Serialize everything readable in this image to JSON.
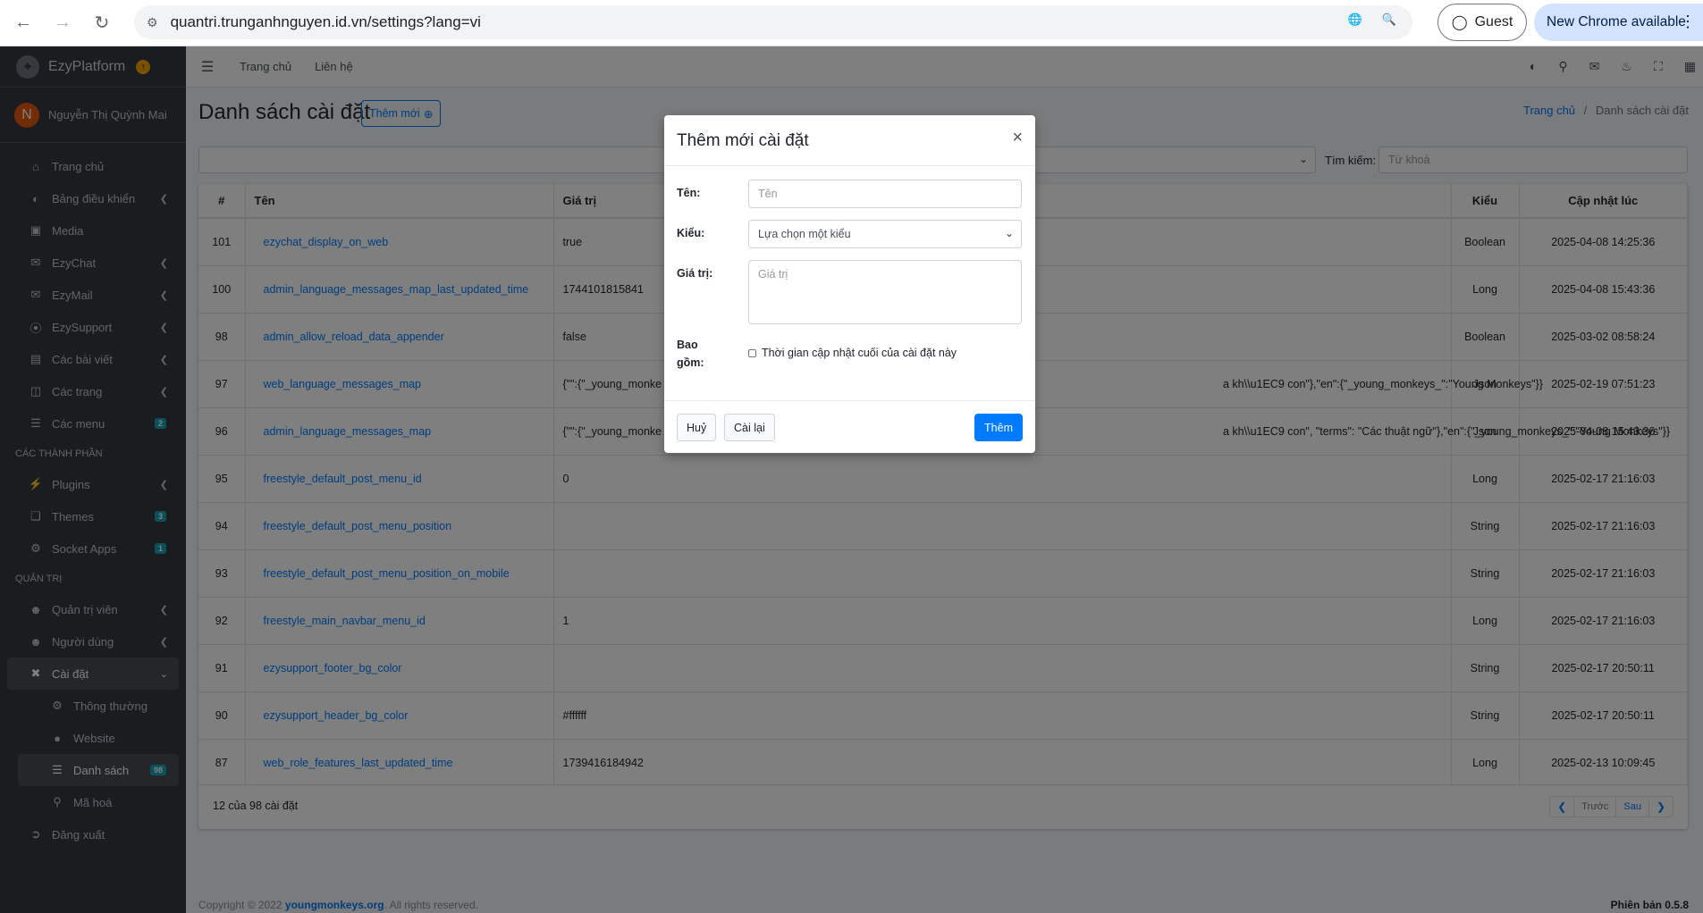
{
  "browser": {
    "url": "quantri.trunganhnguyen.id.vn/settings?lang=vi",
    "profile": "Guest",
    "update": "New Chrome available"
  },
  "brand": {
    "name": "EzyPlatform"
  },
  "user": {
    "initial": "N",
    "name": "Nguyễn Thị Quỳnh Mai"
  },
  "sidebar": {
    "items": [
      {
        "label": "Trang chủ"
      },
      {
        "label": "Bảng điều khiển"
      },
      {
        "label": "Media"
      },
      {
        "label": "EzyChat"
      },
      {
        "label": "EzyMail"
      },
      {
        "label": "EzySupport"
      },
      {
        "label": "Các bài viết"
      },
      {
        "label": "Các trang"
      },
      {
        "label": "Các menu",
        "badge": "2"
      },
      {
        "label": "Plugins"
      },
      {
        "label": "Themes",
        "badge": "3"
      },
      {
        "label": "Socket Apps",
        "badge": "1"
      },
      {
        "label": "Quản trị viên"
      },
      {
        "label": "Người dùng"
      },
      {
        "label": "Cài đặt"
      },
      {
        "label": "Thông thường"
      },
      {
        "label": "Website"
      },
      {
        "label": "Danh sách",
        "badge": "98"
      },
      {
        "label": "Mã hoá"
      },
      {
        "label": "Đăng xuất"
      }
    ],
    "section_components": "CÁC THÀNH PHẦN",
    "section_admin": "QUẢN TRỊ"
  },
  "navbar": {
    "home": "Trang chủ",
    "contact": "Liên hệ"
  },
  "page": {
    "title": "Danh sách cài đặt",
    "add_button": "Thêm mới",
    "breadcrumb_home": "Trang chủ",
    "breadcrumb_sep": "/",
    "breadcrumb_current": "Danh sách cài đặt",
    "search_label": "Tìm kiếm:",
    "search_placeholder": "Từ khoá"
  },
  "table": {
    "headers": [
      "#",
      "Tên",
      "Giá trị",
      "Kiểu",
      "Cập nhật lúc"
    ],
    "rows": [
      {
        "id": "101",
        "name": "ezychat_display_on_web",
        "value": "true",
        "type": "Boolean",
        "updated": "2025-04-08 14:25:36"
      },
      {
        "id": "100",
        "name": "admin_language_messages_map_last_updated_time",
        "value": "1744101815841",
        "type": "Long",
        "updated": "2025-04-08 15:43:36"
      },
      {
        "id": "98",
        "name": "admin_allow_reload_data_appender",
        "value": "false",
        "type": "Boolean",
        "updated": "2025-03-02 08:58:24"
      },
      {
        "id": "97",
        "name": "web_language_messages_map",
        "value": "{\"\":{\"_young_monke",
        "value_tail": "a kh\\\\u1EC9 con\"},\"en\":{\"_young_monkeys_\":\"Young Monkeys\"}}",
        "type": "Json",
        "updated": "2025-02-19 07:51:23"
      },
      {
        "id": "96",
        "name": "admin_language_messages_map",
        "value": "{\"\":{\"_young_monke",
        "value_tail": "a kh\\\\u1EC9 con\", \"terms\": \"Các thuật ngữ\"},\"en\":{\"_young_monkeys_\":\"Young Monkeys\"}}",
        "type": "Json",
        "updated": "2025-04-08 15:43:36"
      },
      {
        "id": "95",
        "name": "freestyle_default_post_menu_id",
        "value": "0",
        "type": "Long",
        "updated": "2025-02-17 21:16:03"
      },
      {
        "id": "94",
        "name": "freestyle_default_post_menu_position",
        "value": "",
        "type": "String",
        "updated": "2025-02-17 21:16:03"
      },
      {
        "id": "93",
        "name": "freestyle_default_post_menu_position_on_mobile",
        "value": "",
        "type": "String",
        "updated": "2025-02-17 21:16:03"
      },
      {
        "id": "92",
        "name": "freestyle_main_navbar_menu_id",
        "value": "1",
        "type": "Long",
        "updated": "2025-02-17 21:16:03"
      },
      {
        "id": "91",
        "name": "ezysupport_footer_bg_color",
        "value": "",
        "type": "String",
        "updated": "2025-02-17 20:50:11"
      },
      {
        "id": "90",
        "name": "ezysupport_header_bg_color",
        "value": "#ffffff",
        "type": "String",
        "updated": "2025-02-17 20:50:11"
      },
      {
        "id": "87",
        "name": "web_role_features_last_updated_time",
        "value": "1739416184942",
        "type": "Long",
        "updated": "2025-02-13 10:09:45"
      }
    ],
    "count_text": "12 của 98 cài đặt",
    "prev": "Trước",
    "next": "Sau"
  },
  "footer": {
    "copyright": "Copyright © 2022",
    "company": "youngmonkeys.org",
    "rights": ". All rights reserved.",
    "version": "Phiên bản 0.5.8"
  },
  "modal": {
    "title": "Thêm mới cài đặt",
    "close": "×",
    "name_label": "Tên:",
    "name_placeholder": "Tên",
    "type_label": "Kiểu:",
    "type_value": "Lựa chọn một kiểu",
    "value_label": "Giá trị:",
    "value_placeholder": "Giá trị",
    "include_label_1": "Bao",
    "include_label_2": "gồm:",
    "include_checkbox": "Thời gian cập nhật cuối của cài đặt này",
    "cancel": "Huỷ",
    "reset": "Cài lại",
    "submit": "Thêm"
  },
  "colors": {
    "primary": "#007bff",
    "sidebar": "#343a40",
    "overlay": "rgba(0,0,0,0.5)"
  }
}
